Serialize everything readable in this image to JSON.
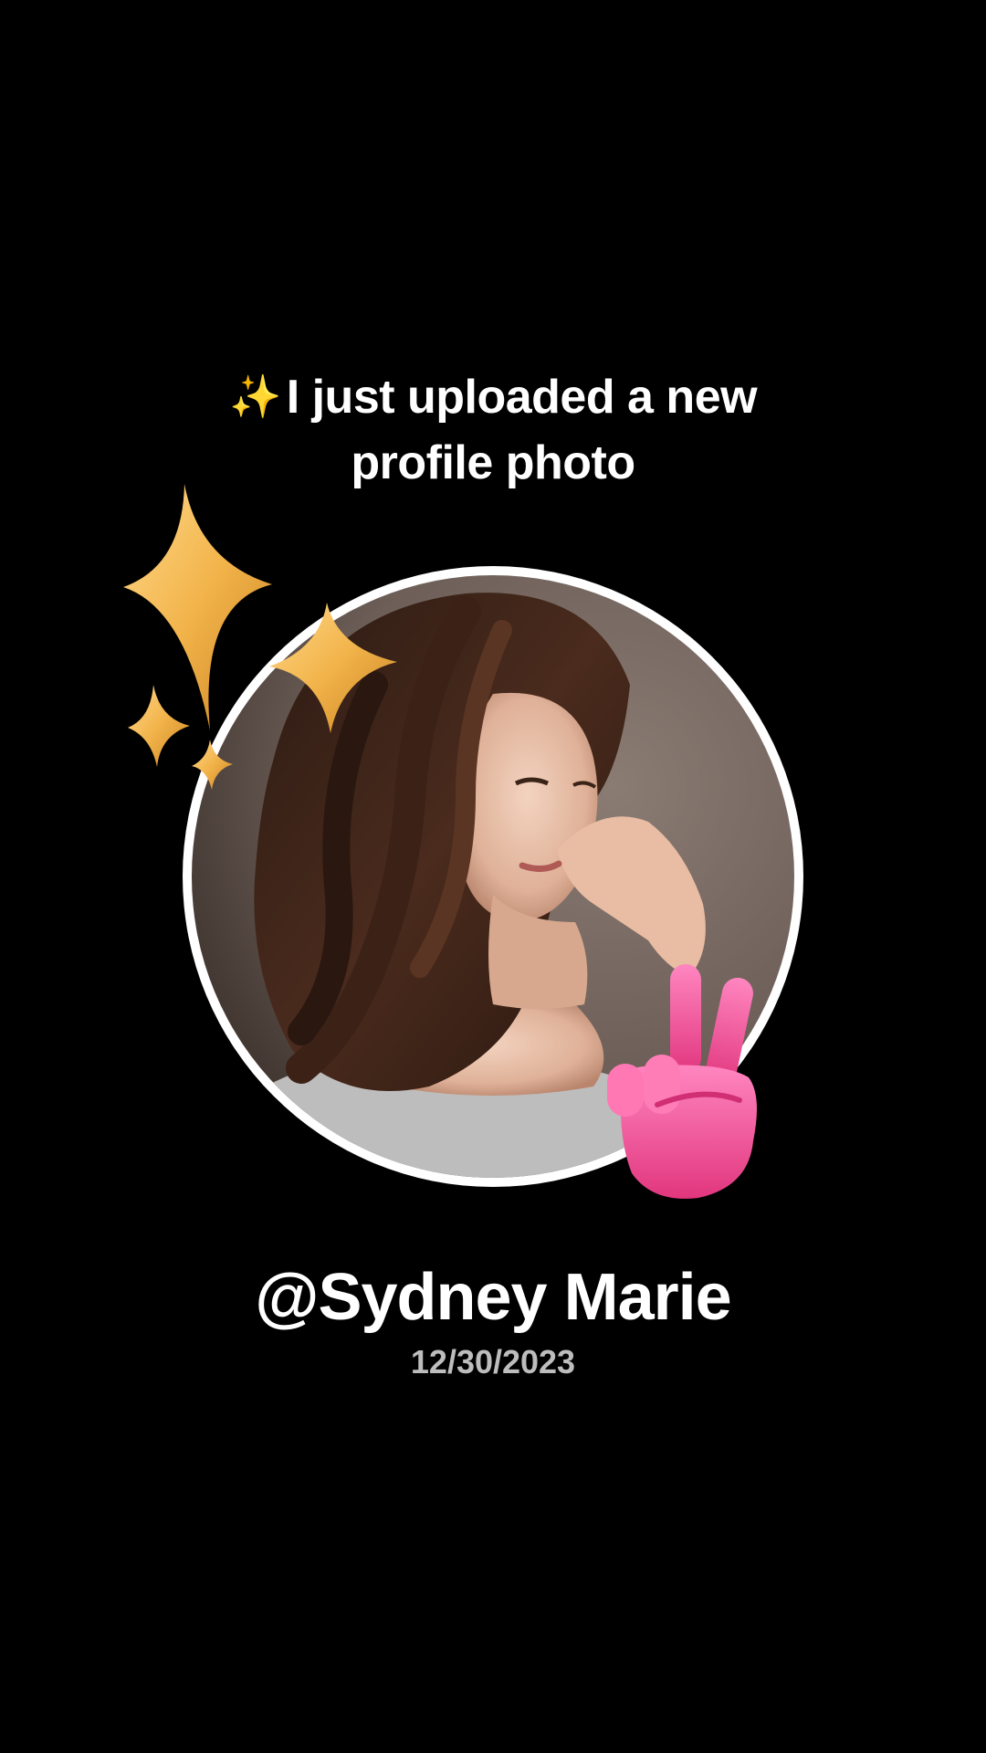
{
  "caption": {
    "sparkle": "✨",
    "text_line1": "I just uploaded a new",
    "text_line2": "profile photo"
  },
  "profile": {
    "username": "@Sydney Marie",
    "date": "12/30/2023"
  },
  "decorations": {
    "stars": "sparkle-stars-icon",
    "hand": "peace-sign-icon"
  },
  "colors": {
    "background": "#000000",
    "text": "#ffffff",
    "date_text": "#bdbdbd",
    "star_gold": "#f2b34a",
    "hand_pink": "#f0549a",
    "avatar_ring": "#ffffff"
  }
}
